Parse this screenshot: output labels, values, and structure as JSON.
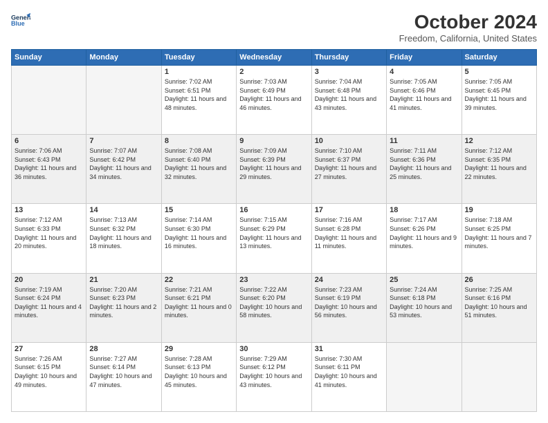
{
  "header": {
    "logo_line1": "General",
    "logo_line2": "Blue",
    "title": "October 2024",
    "location": "Freedom, California, United States"
  },
  "weekdays": [
    "Sunday",
    "Monday",
    "Tuesday",
    "Wednesday",
    "Thursday",
    "Friday",
    "Saturday"
  ],
  "weeks": [
    [
      {
        "day": "",
        "info": ""
      },
      {
        "day": "",
        "info": ""
      },
      {
        "day": "1",
        "info": "Sunrise: 7:02 AM\nSunset: 6:51 PM\nDaylight: 11 hours and 48 minutes."
      },
      {
        "day": "2",
        "info": "Sunrise: 7:03 AM\nSunset: 6:49 PM\nDaylight: 11 hours and 46 minutes."
      },
      {
        "day": "3",
        "info": "Sunrise: 7:04 AM\nSunset: 6:48 PM\nDaylight: 11 hours and 43 minutes."
      },
      {
        "day": "4",
        "info": "Sunrise: 7:05 AM\nSunset: 6:46 PM\nDaylight: 11 hours and 41 minutes."
      },
      {
        "day": "5",
        "info": "Sunrise: 7:05 AM\nSunset: 6:45 PM\nDaylight: 11 hours and 39 minutes."
      }
    ],
    [
      {
        "day": "6",
        "info": "Sunrise: 7:06 AM\nSunset: 6:43 PM\nDaylight: 11 hours and 36 minutes."
      },
      {
        "day": "7",
        "info": "Sunrise: 7:07 AM\nSunset: 6:42 PM\nDaylight: 11 hours and 34 minutes."
      },
      {
        "day": "8",
        "info": "Sunrise: 7:08 AM\nSunset: 6:40 PM\nDaylight: 11 hours and 32 minutes."
      },
      {
        "day": "9",
        "info": "Sunrise: 7:09 AM\nSunset: 6:39 PM\nDaylight: 11 hours and 29 minutes."
      },
      {
        "day": "10",
        "info": "Sunrise: 7:10 AM\nSunset: 6:37 PM\nDaylight: 11 hours and 27 minutes."
      },
      {
        "day": "11",
        "info": "Sunrise: 7:11 AM\nSunset: 6:36 PM\nDaylight: 11 hours and 25 minutes."
      },
      {
        "day": "12",
        "info": "Sunrise: 7:12 AM\nSunset: 6:35 PM\nDaylight: 11 hours and 22 minutes."
      }
    ],
    [
      {
        "day": "13",
        "info": "Sunrise: 7:12 AM\nSunset: 6:33 PM\nDaylight: 11 hours and 20 minutes."
      },
      {
        "day": "14",
        "info": "Sunrise: 7:13 AM\nSunset: 6:32 PM\nDaylight: 11 hours and 18 minutes."
      },
      {
        "day": "15",
        "info": "Sunrise: 7:14 AM\nSunset: 6:30 PM\nDaylight: 11 hours and 16 minutes."
      },
      {
        "day": "16",
        "info": "Sunrise: 7:15 AM\nSunset: 6:29 PM\nDaylight: 11 hours and 13 minutes."
      },
      {
        "day": "17",
        "info": "Sunrise: 7:16 AM\nSunset: 6:28 PM\nDaylight: 11 hours and 11 minutes."
      },
      {
        "day": "18",
        "info": "Sunrise: 7:17 AM\nSunset: 6:26 PM\nDaylight: 11 hours and 9 minutes."
      },
      {
        "day": "19",
        "info": "Sunrise: 7:18 AM\nSunset: 6:25 PM\nDaylight: 11 hours and 7 minutes."
      }
    ],
    [
      {
        "day": "20",
        "info": "Sunrise: 7:19 AM\nSunset: 6:24 PM\nDaylight: 11 hours and 4 minutes."
      },
      {
        "day": "21",
        "info": "Sunrise: 7:20 AM\nSunset: 6:23 PM\nDaylight: 11 hours and 2 minutes."
      },
      {
        "day": "22",
        "info": "Sunrise: 7:21 AM\nSunset: 6:21 PM\nDaylight: 11 hours and 0 minutes."
      },
      {
        "day": "23",
        "info": "Sunrise: 7:22 AM\nSunset: 6:20 PM\nDaylight: 10 hours and 58 minutes."
      },
      {
        "day": "24",
        "info": "Sunrise: 7:23 AM\nSunset: 6:19 PM\nDaylight: 10 hours and 56 minutes."
      },
      {
        "day": "25",
        "info": "Sunrise: 7:24 AM\nSunset: 6:18 PM\nDaylight: 10 hours and 53 minutes."
      },
      {
        "day": "26",
        "info": "Sunrise: 7:25 AM\nSunset: 6:16 PM\nDaylight: 10 hours and 51 minutes."
      }
    ],
    [
      {
        "day": "27",
        "info": "Sunrise: 7:26 AM\nSunset: 6:15 PM\nDaylight: 10 hours and 49 minutes."
      },
      {
        "day": "28",
        "info": "Sunrise: 7:27 AM\nSunset: 6:14 PM\nDaylight: 10 hours and 47 minutes."
      },
      {
        "day": "29",
        "info": "Sunrise: 7:28 AM\nSunset: 6:13 PM\nDaylight: 10 hours and 45 minutes."
      },
      {
        "day": "30",
        "info": "Sunrise: 7:29 AM\nSunset: 6:12 PM\nDaylight: 10 hours and 43 minutes."
      },
      {
        "day": "31",
        "info": "Sunrise: 7:30 AM\nSunset: 6:11 PM\nDaylight: 10 hours and 41 minutes."
      },
      {
        "day": "",
        "info": ""
      },
      {
        "day": "",
        "info": ""
      }
    ]
  ]
}
